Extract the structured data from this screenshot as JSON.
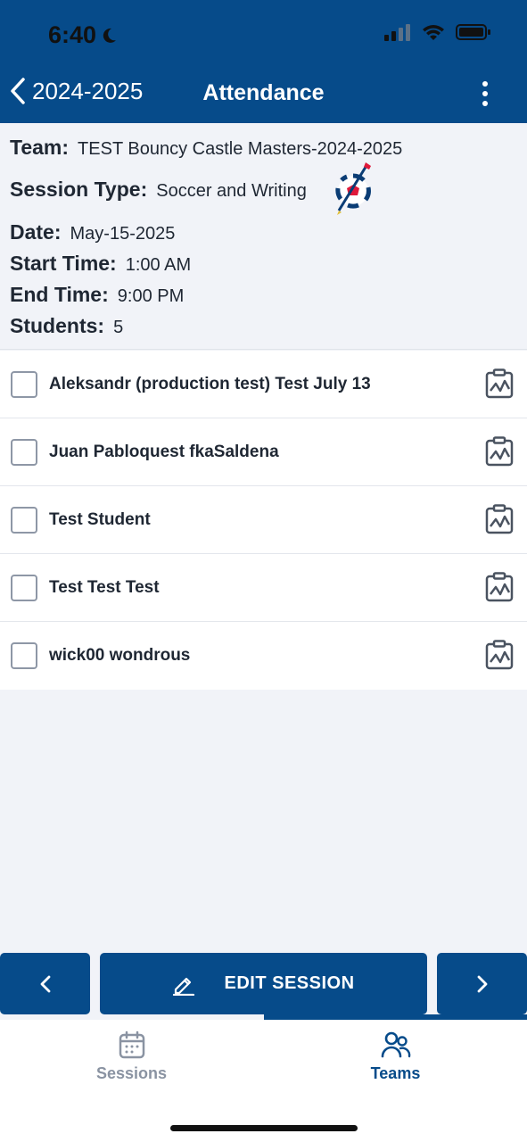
{
  "status_bar": {
    "time": "6:40"
  },
  "nav": {
    "back_label": "2024-2025",
    "title": "Attendance"
  },
  "info": {
    "team_label": "Team:",
    "team_value": "TEST Bouncy Castle Masters-2024-2025",
    "session_type_label": "Session Type:",
    "session_type_value": "Soccer and Writing",
    "date_label": "Date:",
    "date_value": "May-15-2025",
    "start_time_label": "Start Time:",
    "start_time_value": "1:00 AM",
    "end_time_label": "End Time:",
    "end_time_value": "9:00 PM",
    "students_label": "Students:",
    "students_value": "5"
  },
  "students": [
    {
      "name": "Aleksandr (production test) Test July 13",
      "checked": false
    },
    {
      "name": "Juan Pabloquest fkaSaldena",
      "checked": false
    },
    {
      "name": "Test Student",
      "checked": false
    },
    {
      "name": "Test Test Test",
      "checked": false
    },
    {
      "name": "wick00 wondrous",
      "checked": false
    }
  ],
  "actions": {
    "edit_label": "EDIT SESSION"
  },
  "tabs": [
    {
      "label": "Sessions",
      "icon": "calendar-icon",
      "active": false
    },
    {
      "label": "Teams",
      "icon": "people-icon",
      "active": true
    }
  ],
  "colors": {
    "brand": "#064b8a",
    "background": "#f1f3f8",
    "inactive_tab": "#8a93a2"
  }
}
